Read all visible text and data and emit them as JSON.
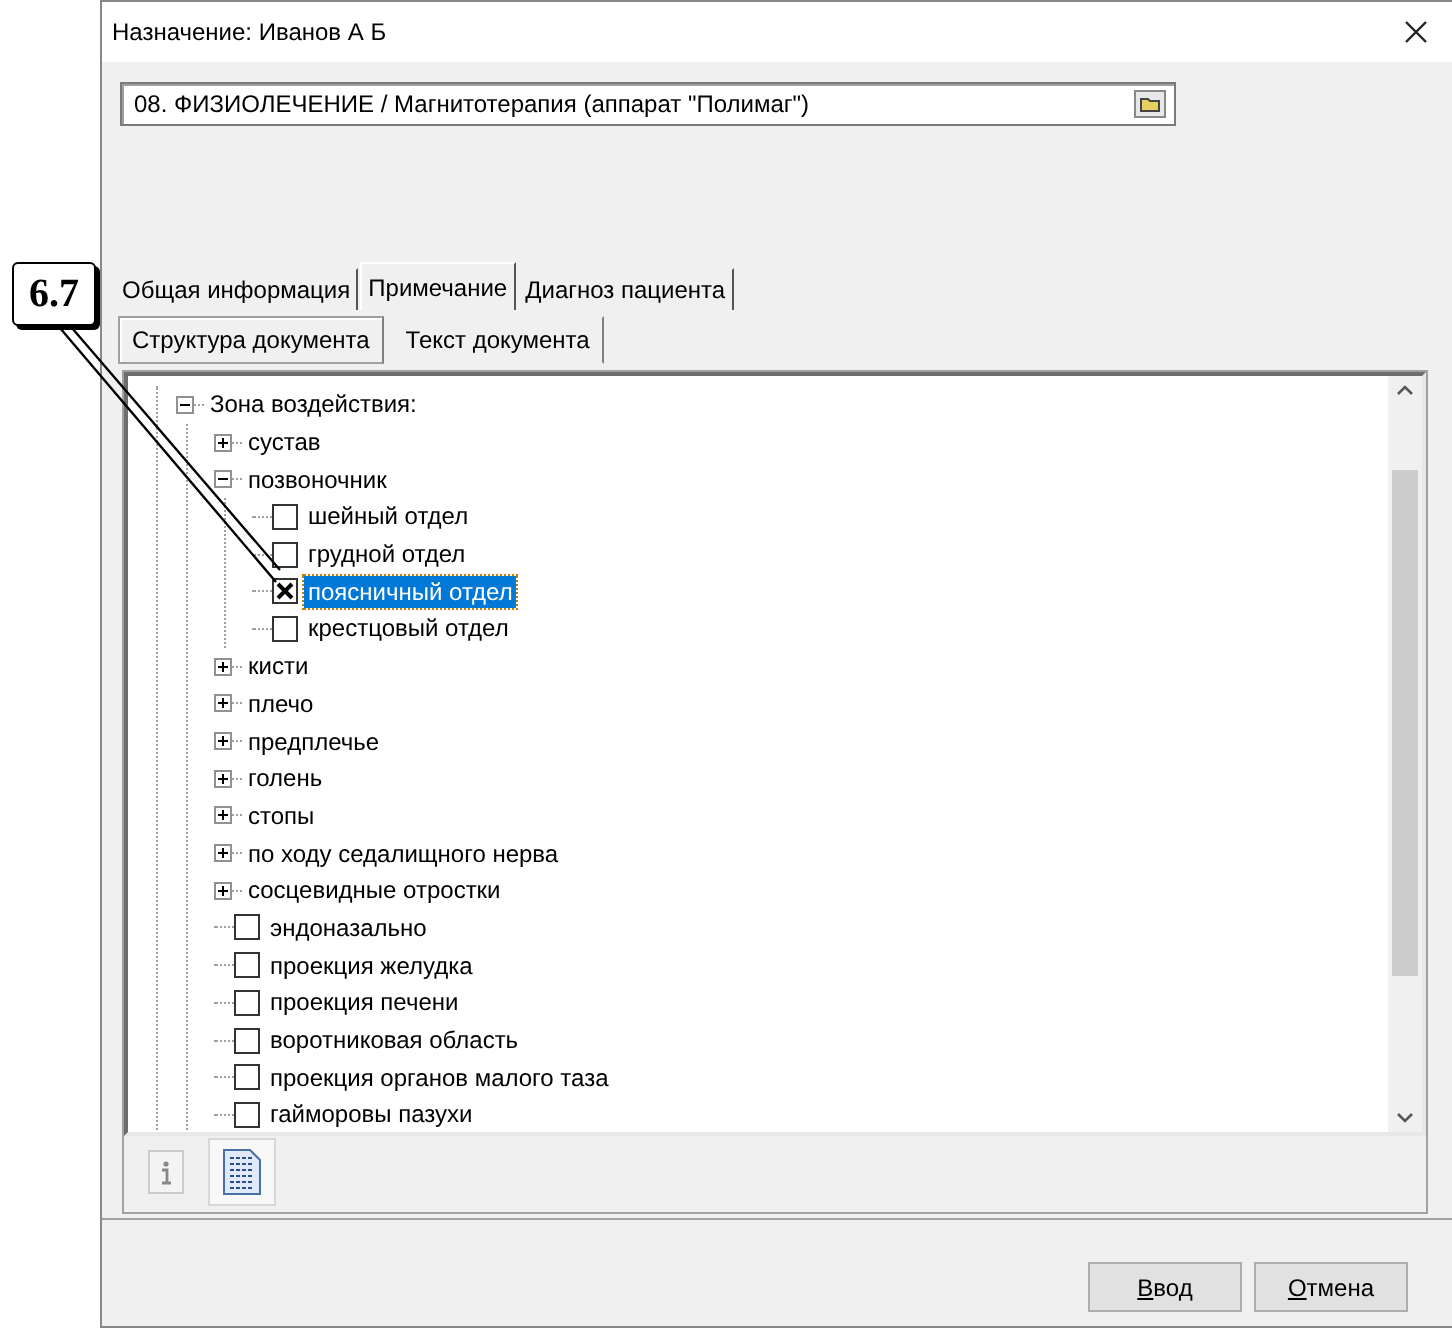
{
  "callout": {
    "label": "6.7"
  },
  "window": {
    "title": "Назначение: Иванов А Б"
  },
  "procedure": {
    "value": "08. ФИЗИОЛЕЧЕНИЕ / Магнитотерапия (аппарат \"Полимаг\")"
  },
  "tabs": [
    {
      "label": "Общая информация",
      "selected": false
    },
    {
      "label": "Примечание",
      "selected": true
    },
    {
      "label": "Диагноз пациента",
      "selected": false
    }
  ],
  "subtabs": [
    {
      "label": "Структура документа",
      "selected": true
    },
    {
      "label": "Текст документа",
      "selected": false
    }
  ],
  "tree": [
    {
      "kind": "branch",
      "label": "Зона воздействия:",
      "expanded": true,
      "children": [
        {
          "kind": "branch",
          "label": "сустав",
          "expanded": false
        },
        {
          "kind": "branch",
          "label": "позвоночник",
          "expanded": true,
          "children": [
            {
              "kind": "check",
              "label": "шейный отдел",
              "checked": false,
              "selected": false
            },
            {
              "kind": "check",
              "label": "грудной отдел",
              "checked": false,
              "selected": false
            },
            {
              "kind": "check",
              "label": "поясничный отдел",
              "checked": true,
              "selected": true
            },
            {
              "kind": "check",
              "label": "крестцовый отдел",
              "checked": false,
              "selected": false
            }
          ]
        },
        {
          "kind": "branch",
          "label": "кисти",
          "expanded": false
        },
        {
          "kind": "branch",
          "label": "плечо",
          "expanded": false
        },
        {
          "kind": "branch",
          "label": "предплечье",
          "expanded": false
        },
        {
          "kind": "branch",
          "label": "голень",
          "expanded": false
        },
        {
          "kind": "branch",
          "label": "стопы",
          "expanded": false
        },
        {
          "kind": "branch",
          "label": "по ходу седалищного нерва",
          "expanded": false
        },
        {
          "kind": "branch",
          "label": "сосцевидные отростки",
          "expanded": false
        },
        {
          "kind": "check",
          "label": "эндоназально",
          "checked": false,
          "selected": false
        },
        {
          "kind": "check",
          "label": "проекция желудка",
          "checked": false,
          "selected": false
        },
        {
          "kind": "check",
          "label": "проекция печени",
          "checked": false,
          "selected": false
        },
        {
          "kind": "check",
          "label": "воротниковая область",
          "checked": false,
          "selected": false
        },
        {
          "kind": "check",
          "label": "проекция органов малого таза",
          "checked": false,
          "selected": false
        },
        {
          "kind": "check",
          "label": "гайморовы пазухи",
          "checked": false,
          "selected": false
        }
      ]
    }
  ],
  "toolbar": [
    {
      "kind": "info",
      "selected": false
    },
    {
      "kind": "document",
      "selected": true
    }
  ],
  "buttons": [
    {
      "label": "Ввод"
    },
    {
      "label": "Отмена"
    }
  ]
}
